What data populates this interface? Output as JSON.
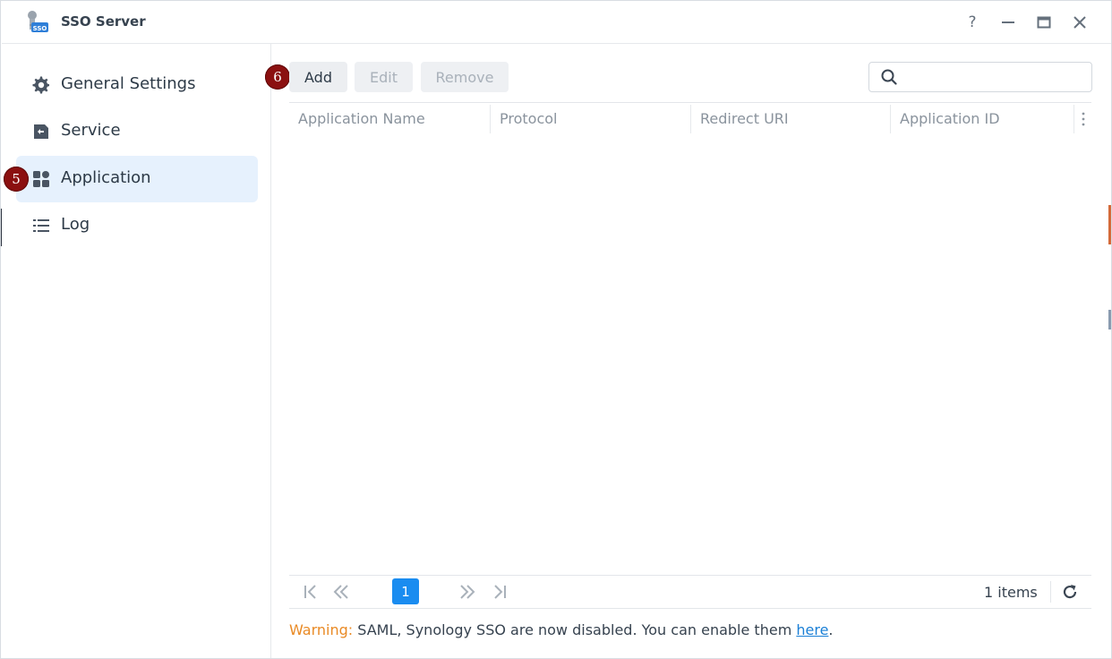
{
  "window": {
    "title": "SSO Server",
    "help_glyph": "?",
    "icon": "sso-app-icon"
  },
  "sidebar": {
    "items": [
      {
        "label": "General Settings",
        "icon": "gear-icon",
        "active": false
      },
      {
        "label": "Service",
        "icon": "service-icon",
        "active": false
      },
      {
        "label": "Application",
        "icon": "grid-icon",
        "active": true
      },
      {
        "label": "Log",
        "icon": "list-icon",
        "active": false
      }
    ]
  },
  "markers": {
    "step5": "5",
    "step6": "6"
  },
  "toolbar": {
    "add_label": "Add",
    "edit_label": "Edit",
    "remove_label": "Remove",
    "search_placeholder": ""
  },
  "table": {
    "columns": [
      "Application Name",
      "Protocol",
      "Redirect URI",
      "Application ID"
    ],
    "rows": []
  },
  "pager": {
    "current_page": "1",
    "count_text": "1 items"
  },
  "warning": {
    "label": "Warning:",
    "text": " SAML, Synology SSO are now disabled. You can enable them ",
    "link": "here",
    "suffix": "."
  },
  "colors": {
    "accent": "#1a8cf0",
    "active_nav_bg": "#e6f1fd",
    "warning": "#e98a25",
    "marker": "#8b1010"
  }
}
